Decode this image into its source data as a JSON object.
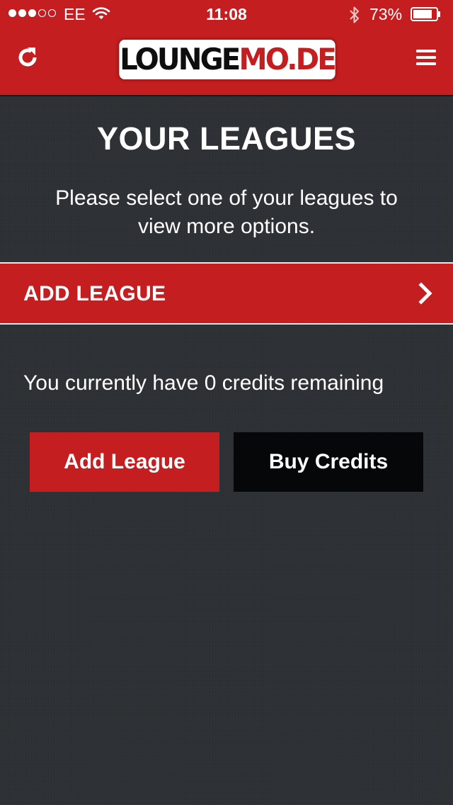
{
  "status_bar": {
    "carrier": "EE",
    "time": "11:08",
    "battery_percent": "73%",
    "battery_level": 0.73,
    "signal_strength": 3,
    "signal_max": 5
  },
  "header": {
    "logo_part1": "LOUNGE",
    "logo_part2": "MO.DE",
    "refresh_icon": "refresh-icon",
    "menu_icon": "hamburger-menu-icon"
  },
  "main": {
    "title": "YOUR LEAGUES",
    "subtitle": "Please select one of your leagues to view more options.",
    "add_league_row_label": "ADD LEAGUE",
    "credits_text": "You currently have 0 credits remaining",
    "add_league_button": "Add League",
    "buy_credits_button": "Buy Credits"
  },
  "colors": {
    "brand_red": "#c41e20",
    "background": "#2d3034",
    "button_dark": "#060708"
  }
}
